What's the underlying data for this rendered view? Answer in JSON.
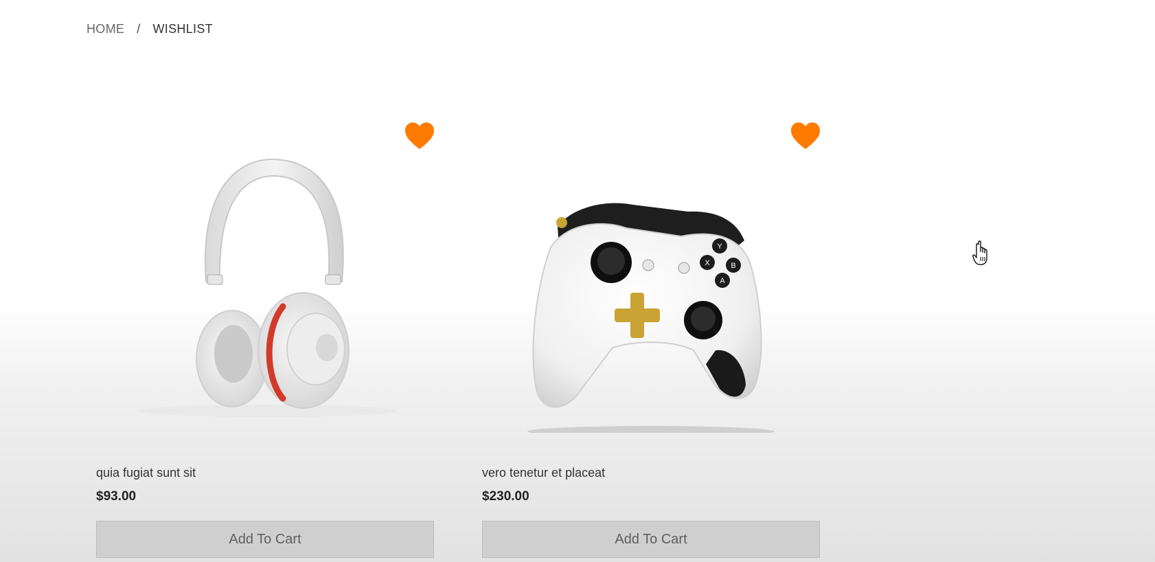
{
  "breadcrumb": {
    "home": "HOME",
    "separator": "/",
    "current": "WISHLIST"
  },
  "products": [
    {
      "name": "quia fugiat sunt sit",
      "price": "$93.00",
      "add_to_cart_label": "Add To Cart",
      "image": "white-headphones",
      "wishlisted": true
    },
    {
      "name": "vero tenetur et placeat",
      "price": "$230.00",
      "add_to_cart_label": "Add To Cart",
      "image": "white-game-controller",
      "wishlisted": true
    }
  ],
  "colors": {
    "heart": "#ff7a00",
    "button_bg": "#cfcfcf",
    "button_text": "#5f5f5f"
  }
}
